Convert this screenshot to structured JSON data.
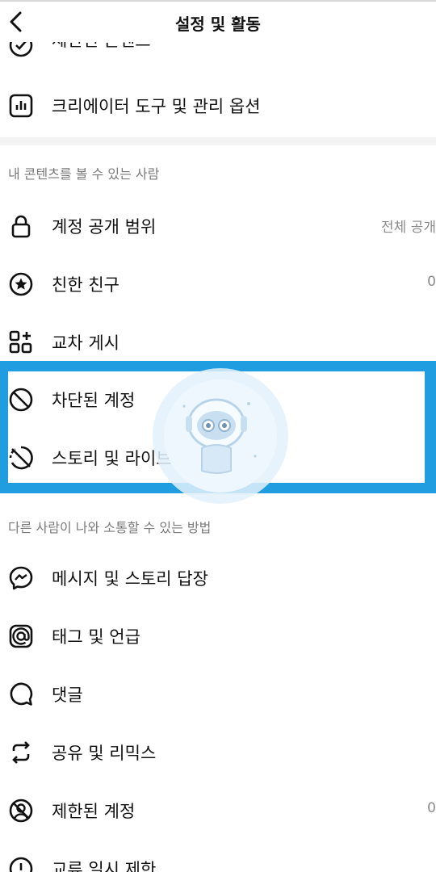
{
  "header": {
    "title": "설정 및 활동",
    "back_icon": "chevron-left-icon"
  },
  "top_items": [
    {
      "label": "제한된 콘텐츠",
      "icon": "check-circle-icon"
    },
    {
      "label": "크리에이터 도구 및 관리 옵션",
      "icon": "bar-chart-icon"
    }
  ],
  "section1": {
    "title": "내 콘텐츠를 볼 수 있는 사람",
    "items": [
      {
        "label": "계정 공개 범위",
        "value": "전체 공개",
        "icon": "lock-icon"
      },
      {
        "label": "친한 친구",
        "value": "0",
        "icon": "star-circle-icon"
      },
      {
        "label": "교차 게시",
        "icon": "add-grid-icon"
      },
      {
        "label": "차단된 계정",
        "icon": "block-icon"
      },
      {
        "label": "스토리 및 라이브 방송 숨기기",
        "icon": "story-hidden-icon"
      }
    ]
  },
  "section2": {
    "title": "다른 사람이 나와 소통할 수 있는 방법",
    "items": [
      {
        "label": "메시지 및 스토리 답장",
        "icon": "messenger-icon"
      },
      {
        "label": "태그 및 언급",
        "icon": "at-sign-icon"
      },
      {
        "label": "댓글",
        "icon": "comment-icon"
      },
      {
        "label": "공유 및 리믹스",
        "icon": "repost-icon"
      },
      {
        "label": "제한된 계정",
        "value": "0",
        "icon": "restricted-user-icon"
      },
      {
        "label": "교류 일시 제한",
        "icon": "alert-circle-icon"
      }
    ]
  },
  "colors": {
    "highlight": "#1f9de0",
    "section_bg": "#f3f3f3",
    "muted_text": "#7a7a7a"
  }
}
